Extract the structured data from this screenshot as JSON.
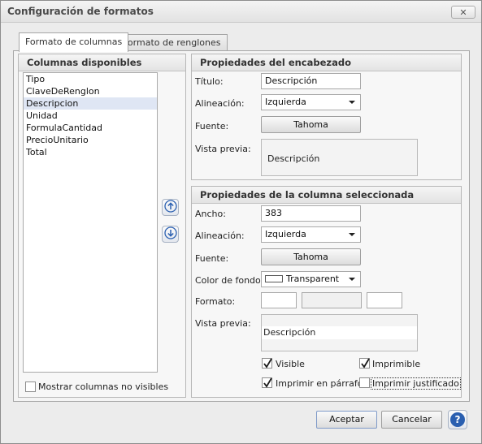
{
  "window": {
    "title": "Configuración de formatos",
    "close_label": "✕"
  },
  "tabs": [
    {
      "label": "Formato de columnas"
    },
    {
      "label": "Formato de renglones"
    }
  ],
  "columns_panel": {
    "header": "Columnas disponibles",
    "items": [
      {
        "label": "Tipo"
      },
      {
        "label": "ClaveDeRenglon"
      },
      {
        "label": "Descripcion"
      },
      {
        "label": "Unidad"
      },
      {
        "label": "FormulaCantidad"
      },
      {
        "label": "PrecioUnitario"
      },
      {
        "label": "Total"
      }
    ],
    "selected_index": 2,
    "show_hidden_label": "Mostrar columnas no visibles",
    "show_hidden_checked": false
  },
  "header_props": {
    "header": "Propiedades del encabezado",
    "title_label": "Título:",
    "title_value": "Descripción",
    "align_label": "Alineación:",
    "align_value": "Izquierda",
    "font_label": "Fuente:",
    "font_value": "Tahoma",
    "preview_label": "Vista previa:",
    "preview_text": "Descripción"
  },
  "column_props": {
    "header": "Propiedades de la columna seleccionada",
    "width_label": "Ancho:",
    "width_value": "383",
    "align_label": "Alineación:",
    "align_value": "Izquierda",
    "font_label": "Fuente:",
    "font_value": "Tahoma",
    "bg_label": "Color de fondo:",
    "bg_value": "Transparent",
    "format_label": "Formato:",
    "preview_label": "Vista previa:",
    "preview_text": "Descripción",
    "visible_label": "Visible",
    "visible_checked": true,
    "printable_label": "Imprimible",
    "printable_checked": true,
    "print_paragraph_label": "Imprimir en párrafo",
    "print_paragraph_checked": true,
    "print_justified_label": "Imprimir justificado",
    "print_justified_checked": false
  },
  "footer": {
    "accept_label": "Aceptar",
    "cancel_label": "Cancelar",
    "help_label": "?"
  },
  "icons": {
    "move_up": "arrow-up-circle-icon",
    "move_down": "arrow-down-circle-icon",
    "help": "help-icon",
    "close": "close-icon"
  },
  "colors": {
    "selection": "#dfe6f4",
    "accent_blue": "#2a5fb0"
  }
}
